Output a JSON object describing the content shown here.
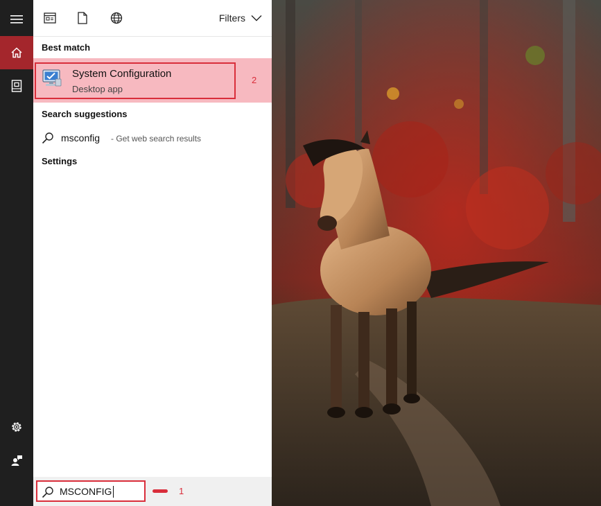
{
  "rail": {
    "items": [
      {
        "icon": "hamburger-menu-icon"
      },
      {
        "icon": "home-icon",
        "active": true
      },
      {
        "icon": "documents-icon"
      },
      {
        "icon": "settings-gear-icon"
      },
      {
        "icon": "user-feedback-icon"
      }
    ],
    "active_color": "#a4262c"
  },
  "topbar": {
    "icons": [
      "news-icon",
      "document-icon",
      "globe-icon"
    ],
    "filters_label": "Filters"
  },
  "best_match": {
    "heading": "Best match",
    "title": "System Configuration",
    "subtitle": "Desktop app",
    "marker": "2",
    "highlight_color": "#f7b9c0"
  },
  "suggestions": {
    "heading": "Search suggestions",
    "items": [
      {
        "term": "msconfig",
        "hint": "- Get web search results"
      }
    ]
  },
  "settings": {
    "heading": "Settings"
  },
  "search": {
    "value": "MSCONFIG",
    "marker": "1"
  },
  "annotation_color": "#d92d3a"
}
